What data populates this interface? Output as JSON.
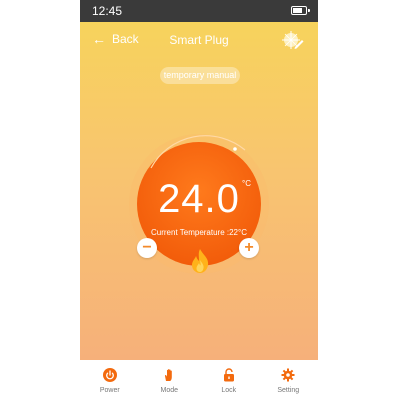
{
  "status_bar": {
    "time": "12:45"
  },
  "header": {
    "back_label": "Back",
    "title": "Smart Plug"
  },
  "mode_badge": "temporary manual",
  "thermostat": {
    "set_temperature": "24.0",
    "unit": "°C",
    "current_label": "Current Temperature :22°C"
  },
  "controls": {
    "minus": "−",
    "plus": "+"
  },
  "tabs": [
    {
      "label": "Power",
      "icon": "power-icon"
    },
    {
      "label": "Mode",
      "icon": "hand-icon"
    },
    {
      "label": "Lock",
      "icon": "lock-icon"
    },
    {
      "label": "Setting",
      "icon": "gear-icon"
    }
  ],
  "colors": {
    "accent": "#f36a0e",
    "ring": "#ff8a2c",
    "background_top": "#f7d35c",
    "background_bottom": "#f6b07a"
  }
}
